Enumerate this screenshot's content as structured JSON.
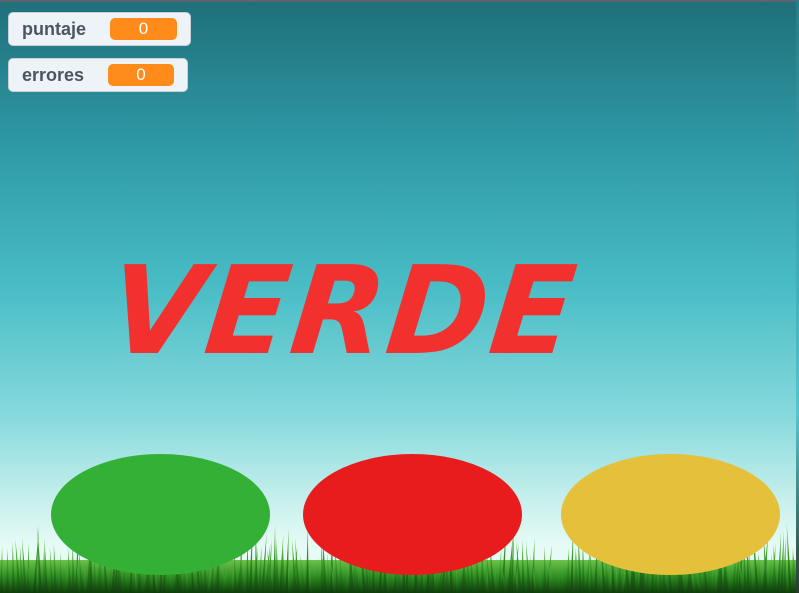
{
  "monitors": {
    "score": {
      "label": "puntaje",
      "value": "0"
    },
    "errors": {
      "label": "errores",
      "value": "0"
    }
  },
  "prompt_word": "VERDE",
  "colors": {
    "sky_top": "#1f6f7a",
    "sky_bottom": "#e6fbf6",
    "word": "#f2302e",
    "monitor_value_bg": "#ff8c1a",
    "green_button": "#33b035",
    "red_button": "#e81c1c",
    "yellow_button": "#e4c03b",
    "grass": "#2e9a1f"
  },
  "buttons": [
    {
      "name": "green-oval-button",
      "color": "#33b035"
    },
    {
      "name": "red-oval-button",
      "color": "#e81c1c"
    },
    {
      "name": "yellow-oval-button",
      "color": "#e4c03b"
    }
  ]
}
